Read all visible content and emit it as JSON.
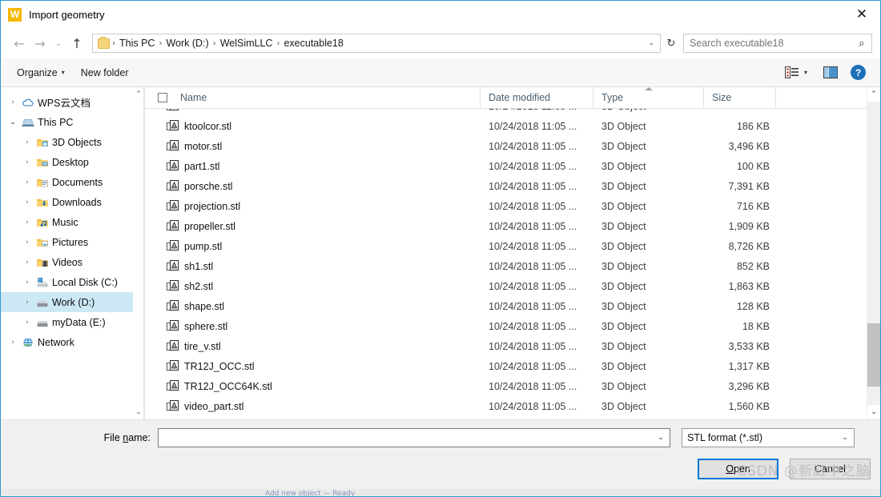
{
  "window": {
    "title": "Import geometry",
    "app_icon_letter": "W",
    "app_icon_color": "#f5b800",
    "close_glyph": "✕"
  },
  "address_bar": {
    "back_glyph": "←",
    "forward_glyph": "→",
    "history_glyph": "⌄",
    "up_glyph": "↑",
    "breadcrumbs": [
      "This PC",
      "Work (D:)",
      "WelSimLLC",
      "executable18"
    ],
    "separator": "›",
    "dropdown_glyph": "⌄",
    "refresh_glyph": "↻",
    "search_placeholder": "Search executable18",
    "search_value": "",
    "search_icon_glyph": "⌕"
  },
  "command_bar": {
    "organize_label": "Organize",
    "organize_caret": "▾",
    "new_folder_label": "New folder",
    "view_caret": "▾",
    "help_label": "?"
  },
  "sidebar": {
    "items": [
      {
        "label": "WPS云文档",
        "indent": 0,
        "expander": "›",
        "icon": "cloud-icon",
        "selected": false
      },
      {
        "label": "This PC",
        "indent": 0,
        "expander": "⌄",
        "icon": "pc-icon",
        "selected": false
      },
      {
        "label": "3D Objects",
        "indent": 1,
        "expander": "›",
        "icon": "folder-3d-icon",
        "selected": false
      },
      {
        "label": "Desktop",
        "indent": 1,
        "expander": "›",
        "icon": "folder-desktop-icon",
        "selected": false
      },
      {
        "label": "Documents",
        "indent": 1,
        "expander": "›",
        "icon": "folder-documents-icon",
        "selected": false
      },
      {
        "label": "Downloads",
        "indent": 1,
        "expander": "›",
        "icon": "folder-downloads-icon",
        "selected": false
      },
      {
        "label": "Music",
        "indent": 1,
        "expander": "›",
        "icon": "folder-music-icon",
        "selected": false
      },
      {
        "label": "Pictures",
        "indent": 1,
        "expander": "›",
        "icon": "folder-pictures-icon",
        "selected": false
      },
      {
        "label": "Videos",
        "indent": 1,
        "expander": "›",
        "icon": "folder-videos-icon",
        "selected": false
      },
      {
        "label": "Local Disk (C:)",
        "indent": 1,
        "expander": "›",
        "icon": "windows-drive-icon",
        "selected": false
      },
      {
        "label": "Work (D:)",
        "indent": 1,
        "expander": "›",
        "icon": "drive-icon",
        "selected": true
      },
      {
        "label": "myData (E:)",
        "indent": 1,
        "expander": "›",
        "icon": "drive-icon",
        "selected": false
      },
      {
        "label": "Network",
        "indent": 0,
        "expander": "›",
        "icon": "network-icon",
        "selected": false
      }
    ],
    "scroll_up_glyph": "⌃",
    "scroll_down_glyph": "⌄"
  },
  "file_list": {
    "columns": [
      {
        "key": "name",
        "label": "Name",
        "sorted": false
      },
      {
        "key": "date",
        "label": "Date modified",
        "sorted": false
      },
      {
        "key": "type",
        "label": "Type",
        "sorted": true
      },
      {
        "key": "size",
        "label": "Size",
        "sorted": false
      }
    ],
    "select_all_checked": false,
    "clipped_top_row": {
      "name": "",
      "date": "",
      "type": "",
      "size": ""
    },
    "rows": [
      {
        "name": "ktoolcor.stl",
        "date": "10/24/2018 11:05 ...",
        "type": "3D Object",
        "size": "186 KB"
      },
      {
        "name": "motor.stl",
        "date": "10/24/2018 11:05 ...",
        "type": "3D Object",
        "size": "3,496 KB"
      },
      {
        "name": "part1.stl",
        "date": "10/24/2018 11:05 ...",
        "type": "3D Object",
        "size": "100 KB"
      },
      {
        "name": "porsche.stl",
        "date": "10/24/2018 11:05 ...",
        "type": "3D Object",
        "size": "7,391 KB"
      },
      {
        "name": "projection.stl",
        "date": "10/24/2018 11:05 ...",
        "type": "3D Object",
        "size": "716 KB"
      },
      {
        "name": "propeller.stl",
        "date": "10/24/2018 11:05 ...",
        "type": "3D Object",
        "size": "1,909 KB"
      },
      {
        "name": "pump.stl",
        "date": "10/24/2018 11:05 ...",
        "type": "3D Object",
        "size": "8,726 KB"
      },
      {
        "name": "sh1.stl",
        "date": "10/24/2018 11:05 ...",
        "type": "3D Object",
        "size": "852 KB"
      },
      {
        "name": "sh2.stl",
        "date": "10/24/2018 11:05 ...",
        "type": "3D Object",
        "size": "1,863 KB"
      },
      {
        "name": "shape.stl",
        "date": "10/24/2018 11:05 ...",
        "type": "3D Object",
        "size": "128 KB"
      },
      {
        "name": "sphere.stl",
        "date": "10/24/2018 11:05 ...",
        "type": "3D Object",
        "size": "18 KB"
      },
      {
        "name": "tire_v.stl",
        "date": "10/24/2018 11:05 ...",
        "type": "3D Object",
        "size": "3,533 KB"
      },
      {
        "name": "TR12J_OCC.stl",
        "date": "10/24/2018 11:05 ...",
        "type": "3D Object",
        "size": "1,317 KB"
      },
      {
        "name": "TR12J_OCC64K.stl",
        "date": "10/24/2018 11:05 ...",
        "type": "3D Object",
        "size": "3,296 KB"
      },
      {
        "name": "video_part.stl",
        "date": "10/24/2018 11:05 ...",
        "type": "3D Object",
        "size": "1,560 KB"
      }
    ],
    "scroll_up_glyph": "⌃",
    "scroll_down_glyph": "⌄",
    "scroll_thumb_top_pct": 73,
    "scroll_thumb_height_pct": 21
  },
  "footer": {
    "file_name_label_pre": "File ",
    "file_name_label_key": "n",
    "file_name_label_post": "ame:",
    "file_name_value": "",
    "file_name_placeholder": "",
    "file_name_chevron": "⌄",
    "filter_value": "STL format (*.stl)",
    "filter_chevron": "⌄",
    "open_label_pre": "",
    "open_label_key": "O",
    "open_label_post": "pen",
    "cancel_label": "Cancel"
  },
  "watermark": {
    "text": "CSDN @新缸中之脑"
  },
  "background_window": {
    "blurred_text": "Add new object — Ready"
  },
  "colors": {
    "dialog_border": "#2e9ad0",
    "selection": "#cce8f4",
    "accent": "#0078d7",
    "header_text": "#4a6070",
    "app_icon": "#f5b800"
  }
}
